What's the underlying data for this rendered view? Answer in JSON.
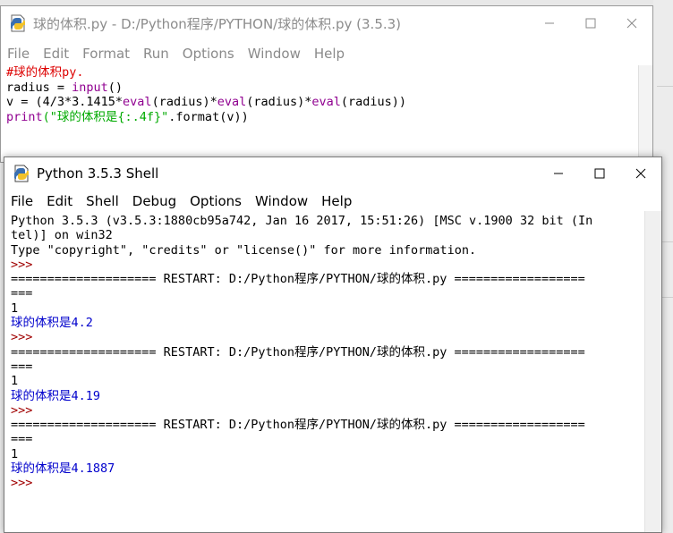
{
  "editor": {
    "title": "球的体积.py - D:/Python程序/PYTHON/球的体积.py (3.5.3)",
    "menu": [
      "File",
      "Edit",
      "Format",
      "Run",
      "Options",
      "Window",
      "Help"
    ],
    "code": [
      [
        {
          "t": "#球的体积py.",
          "k": "comment"
        }
      ],
      [
        {
          "t": "radius = ",
          "k": "plain"
        },
        {
          "t": "input",
          "k": "builtin"
        },
        {
          "t": "()",
          "k": "plain"
        }
      ],
      [
        {
          "t": "v = (4/3*3.1415*",
          "k": "plain"
        },
        {
          "t": "eval",
          "k": "builtin"
        },
        {
          "t": "(radius)*",
          "k": "plain"
        },
        {
          "t": "eval",
          "k": "builtin"
        },
        {
          "t": "(radius)*",
          "k": "plain"
        },
        {
          "t": "eval",
          "k": "builtin"
        },
        {
          "t": "(radius))",
          "k": "plain"
        }
      ],
      [
        {
          "t": "print",
          "k": "builtin"
        },
        {
          "t": "(\"球的体积是{:.4f}\"",
          "k": "string"
        },
        {
          "t": ".format(v))",
          "k": "plain"
        }
      ]
    ]
  },
  "shell": {
    "title": "Python 3.5.3 Shell",
    "menu": [
      "File",
      "Edit",
      "Shell",
      "Debug",
      "Options",
      "Window",
      "Help"
    ],
    "lines": [
      {
        "t": "Python 3.5.3 (v3.5.3:1880cb95a742, Jan 16 2017, 15:51:26) [MSC v.1900 32 bit (In",
        "k": "plain"
      },
      {
        "t": "tel)] on win32",
        "k": "plain"
      },
      {
        "t": "Type \"copyright\", \"credits\" or \"license()\" for more information.",
        "k": "plain"
      },
      {
        "t": ">>>",
        "k": "prompt"
      },
      {
        "t": "==================== RESTART: D:/Python程序/PYTHON/球的体积.py ==================",
        "k": "plain"
      },
      {
        "t": "===",
        "k": "plain"
      },
      {
        "t": "1",
        "k": "plain"
      },
      {
        "t": "球的体积是4.2",
        "k": "out"
      },
      {
        "t": ">>>",
        "k": "prompt"
      },
      {
        "t": "==================== RESTART: D:/Python程序/PYTHON/球的体积.py ==================",
        "k": "plain"
      },
      {
        "t": "===",
        "k": "plain"
      },
      {
        "t": "1",
        "k": "plain"
      },
      {
        "t": "球的体积是4.19",
        "k": "out"
      },
      {
        "t": ">>>",
        "k": "prompt"
      },
      {
        "t": "==================== RESTART: D:/Python程序/PYTHON/球的体积.py ==================",
        "k": "plain"
      },
      {
        "t": "===",
        "k": "plain"
      },
      {
        "t": "1",
        "k": "plain"
      },
      {
        "t": "球的体积是4.1887",
        "k": "out"
      },
      {
        "t": ">>>",
        "k": "prompt"
      }
    ]
  },
  "icons": {
    "app": "python-idle-icon",
    "minimize": "minimize-icon",
    "maximize": "maximize-icon",
    "close": "close-icon"
  },
  "colors": {
    "comment": "#dd0000",
    "builtin": "#900090",
    "string": "#00aa00",
    "prompt": "#a00000",
    "output": "#0000cc"
  }
}
